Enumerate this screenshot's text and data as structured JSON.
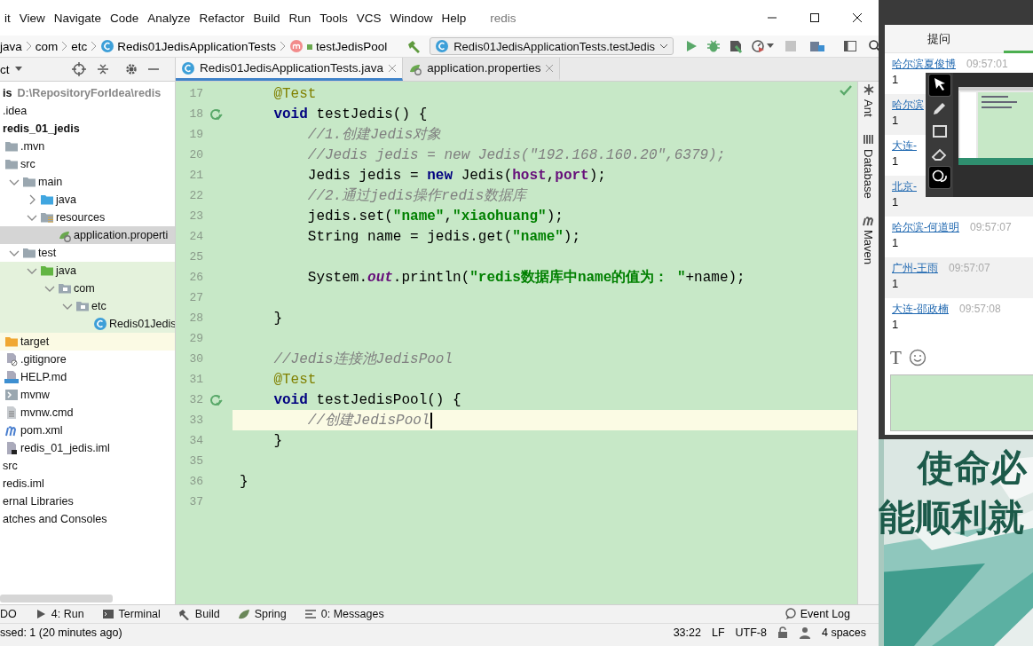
{
  "menu": {
    "items": [
      "it",
      "View",
      "Navigate",
      "Code",
      "Analyze",
      "Refactor",
      "Build",
      "Run",
      "Tools",
      "VCS",
      "Window",
      "Help"
    ],
    "title": "redis"
  },
  "breadcrumbs": [
    {
      "kind": "package",
      "label": "java"
    },
    {
      "kind": "package",
      "label": "com"
    },
    {
      "kind": "package",
      "label": "etc"
    },
    {
      "kind": "class",
      "label": "Redis01JedisApplicationTests"
    },
    {
      "kind": "method",
      "label": "testJedisPool"
    }
  ],
  "run_config": "Redis01JedisApplicationTests.testJedis",
  "project_view": "ct",
  "editor_tabs": [
    {
      "label": "Redis01JedisApplicationTests.java",
      "kind": "class",
      "selected": true
    },
    {
      "label": "application.properties",
      "kind": "properties",
      "selected": false
    }
  ],
  "tree": [
    {
      "label": "is",
      "path": "D:\\RepositoryForIdea\\redis",
      "kind": "text",
      "bold": true,
      "selected": false,
      "children": [
        {
          "label": ".idea",
          "kind": "text",
          "selected": false
        },
        {
          "label": "redis_01_jedis",
          "kind": "text",
          "bold": true,
          "selected": false,
          "children": [
            {
              "label": ".mvn",
              "kind": "folder",
              "selected": false
            },
            {
              "label": "src",
              "kind": "folder",
              "selected": false,
              "children": [
                {
                  "label": "main",
                  "kind": "folder",
                  "expanded": true,
                  "selected": false,
                  "children": [
                    {
                      "label": "java",
                      "kind": "source",
                      "expanded": false,
                      "selected": false
                    },
                    {
                      "label": "resources",
                      "kind": "resources",
                      "expanded": true,
                      "selected": false,
                      "children": [
                        {
                          "label": "application.properti",
                          "kind": "properties",
                          "selected": true
                        }
                      ]
                    }
                  ]
                },
                {
                  "label": "test",
                  "kind": "folder",
                  "expanded": true,
                  "selected": false,
                  "children": [
                    {
                      "label": "java",
                      "kind": "test",
                      "expanded": true,
                      "selected": false,
                      "color": "#e4f2dc",
                      "children": [
                        {
                          "label": "com",
                          "kind": "package",
                          "expanded": true,
                          "selected": false,
                          "color": "#e4f2dc",
                          "children": [
                            {
                              "label": "etc",
                              "kind": "package",
                              "expanded": true,
                              "selected": false,
                              "color": "#e4f2dc",
                              "children": [
                                {
                                  "label": "Redis01Jedis",
                                  "kind": "class",
                                  "selected": false,
                                  "color": "#e4f2dc"
                                }
                              ]
                            }
                          ]
                        }
                      ]
                    }
                  ]
                }
              ]
            },
            {
              "label": "target",
              "kind": "excluded",
              "selected": false,
              "color": "#fbfae4"
            },
            {
              "label": ".gitignore",
              "kind": "ignore",
              "selected": false
            },
            {
              "label": "HELP.md",
              "kind": "markdown",
              "selected": false
            },
            {
              "label": "mvnw",
              "kind": "shell",
              "selected": false
            },
            {
              "label": "mvnw.cmd",
              "kind": "plainfile",
              "selected": false
            },
            {
              "label": "pom.xml",
              "kind": "maven",
              "selected": false
            },
            {
              "label": "redis_01_jedis.iml",
              "kind": "module",
              "selected": false
            }
          ]
        },
        {
          "label": "src",
          "kind": "text",
          "selected": false
        },
        {
          "label": "redis.iml",
          "kind": "text",
          "selected": false
        }
      ]
    },
    {
      "label": "ernal Libraries",
      "kind": "text",
      "selected": false
    },
    {
      "label": "atches and Consoles",
      "kind": "text",
      "selected": false
    }
  ],
  "editor": {
    "lines": [
      {
        "number": "17",
        "run": false,
        "current": false,
        "tokens": [
          {
            "text": "    @Test",
            "kind": "annotation"
          }
        ]
      },
      {
        "number": "18",
        "run": true,
        "current": false,
        "tokens": [
          {
            "text": "    void",
            "kind": "keyword"
          },
          {
            "text": " testJedis() {",
            "kind": "plain"
          }
        ]
      },
      {
        "number": "19",
        "run": false,
        "current": false,
        "tokens": [
          {
            "text": "        //1.创建Jedis对象",
            "kind": "comment"
          }
        ]
      },
      {
        "number": "20",
        "run": false,
        "current": false,
        "tokens": [
          {
            "text": "        //Jedis jedis = new Jedis(\"192.168.160.20\",6379);",
            "kind": "comment"
          }
        ]
      },
      {
        "number": "21",
        "run": false,
        "current": false,
        "tokens": [
          {
            "text": "        Jedis jedis = ",
            "kind": "plain"
          },
          {
            "text": "new",
            "kind": "keyword"
          },
          {
            "text": " Jedis(",
            "kind": "plain"
          },
          {
            "text": "host",
            "kind": "field"
          },
          {
            "text": ",",
            "kind": "plain"
          },
          {
            "text": "port",
            "kind": "field"
          },
          {
            "text": ");",
            "kind": "plain"
          }
        ]
      },
      {
        "number": "22",
        "run": false,
        "current": false,
        "tokens": [
          {
            "text": "        //2.通过jedis操作redis数据库",
            "kind": "comment"
          }
        ]
      },
      {
        "number": "23",
        "run": false,
        "current": false,
        "tokens": [
          {
            "text": "        jedis.set(",
            "kind": "plain"
          },
          {
            "text": "\"name\"",
            "kind": "string"
          },
          {
            "text": ",",
            "kind": "plain"
          },
          {
            "text": "\"xiaohuang\"",
            "kind": "string"
          },
          {
            "text": ");",
            "kind": "plain"
          }
        ]
      },
      {
        "number": "24",
        "run": false,
        "current": false,
        "tokens": [
          {
            "text": "        String name = jedis.get(",
            "kind": "plain"
          },
          {
            "text": "\"name\"",
            "kind": "string"
          },
          {
            "text": ");",
            "kind": "plain"
          }
        ]
      },
      {
        "number": "25",
        "run": false,
        "current": false
      },
      {
        "number": "26",
        "run": false,
        "current": false,
        "tokens": [
          {
            "text": "        System.",
            "kind": "plain"
          },
          {
            "text": "out",
            "kind": "static"
          },
          {
            "text": ".println(",
            "kind": "plain"
          },
          {
            "text": "\"redis数据库中name的值为： \"",
            "kind": "string"
          },
          {
            "text": "+name);",
            "kind": "plain"
          }
        ]
      },
      {
        "number": "27",
        "run": false,
        "current": false
      },
      {
        "number": "28",
        "run": false,
        "current": false,
        "tokens": [
          {
            "text": "    }",
            "kind": "plain"
          }
        ]
      },
      {
        "number": "29",
        "run": false,
        "current": false
      },
      {
        "number": "30",
        "run": false,
        "current": false,
        "tokens": [
          {
            "text": "    //Jedis连接池JedisPool",
            "kind": "comment"
          }
        ]
      },
      {
        "number": "31",
        "run": false,
        "current": false,
        "tokens": [
          {
            "text": "    @Test",
            "kind": "annotation"
          }
        ]
      },
      {
        "number": "32",
        "run": true,
        "current": false,
        "tokens": [
          {
            "text": "    void",
            "kind": "keyword"
          },
          {
            "text": " testJedisPool() {",
            "kind": "plain"
          }
        ]
      },
      {
        "number": "33",
        "run": false,
        "current": true,
        "tokens": [
          {
            "text": "        //创建JedisPool",
            "kind": "comment"
          }
        ]
      },
      {
        "number": "34",
        "run": false,
        "current": false,
        "tokens": [
          {
            "text": "    }",
            "kind": "plain"
          }
        ]
      },
      {
        "number": "35",
        "run": false,
        "current": false
      },
      {
        "number": "36",
        "run": false,
        "current": false,
        "tokens": [
          {
            "text": "}",
            "kind": "plain"
          }
        ]
      },
      {
        "number": "37",
        "run": false,
        "current": false
      }
    ]
  },
  "side_tools": [
    {
      "label": "Ant",
      "kind": "ant"
    },
    {
      "label": "Database",
      "kind": "database"
    },
    {
      "label": "Maven",
      "kind": "maven"
    }
  ],
  "tool_windows": [
    {
      "label": "DO",
      "kind": "todo"
    },
    {
      "label": "4: Run",
      "kind": "run"
    },
    {
      "label": "Terminal",
      "kind": "terminal"
    },
    {
      "label": "Build",
      "kind": "build"
    },
    {
      "label": "Spring",
      "kind": "spring"
    },
    {
      "label": "0: Messages",
      "kind": "messages"
    }
  ],
  "event_log": "Event Log",
  "status": {
    "message": "ssed: 1 (20 minutes ago)",
    "position": "33:22",
    "line_separator": "LF",
    "encoding": "UTF-8",
    "indent": "4 spaces"
  },
  "chat": {
    "tab": "提问",
    "messages": [
      {
        "author": "哈尔滨夏俊博",
        "time": "09:57:01",
        "text": "1"
      },
      {
        "author": "哈尔滨",
        "text": "1"
      },
      {
        "author": "大连-",
        "text": "1"
      },
      {
        "author": "北京-",
        "text": "1"
      },
      {
        "author": "哈尔滨-何道明",
        "time": "09:57:07",
        "text": "1"
      },
      {
        "author": "广州-王雨",
        "time": "09:57:07",
        "text": "1"
      },
      {
        "author": "大连-邵政楠",
        "time": "09:57:08",
        "text": "1"
      }
    ],
    "format_button": "T",
    "draw_tools": [
      {
        "kind": "pointer",
        "selected": true
      },
      {
        "kind": "pencil",
        "selected": false
      },
      {
        "kind": "rectangle",
        "selected": false
      },
      {
        "kind": "eraser",
        "selected": false
      },
      {
        "kind": "comment",
        "selected": true
      }
    ]
  },
  "backdrop": {
    "lines": [
      "使命必",
      "能顺利就"
    ]
  }
}
